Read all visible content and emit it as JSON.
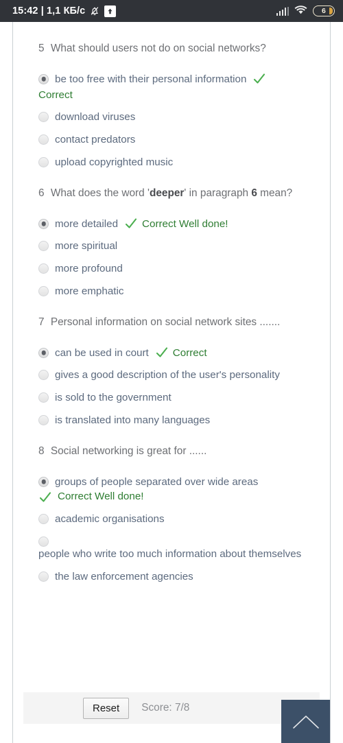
{
  "statusbar": {
    "clock": "15:42 | 1,1 КБ/с",
    "bell_icon": "bell-muted-icon",
    "upload_icon": "upload-arrow-icon",
    "signal_icon": "signal-bars-icon",
    "wifi_icon": "wifi-icon",
    "battery_level": "6"
  },
  "quiz": {
    "questions": [
      {
        "number": "5",
        "text": "What should users not do on social networks?",
        "options": [
          {
            "label": "be too free with their personal information",
            "selected": true,
            "mark": "check",
            "feedback": "Correct",
            "feedback_below": true
          },
          {
            "label": "download viruses",
            "selected": false
          },
          {
            "label": "contact predators",
            "selected": false
          },
          {
            "label": "upload copyrighted music",
            "selected": false
          }
        ]
      },
      {
        "number": "6",
        "text_before": "What does the word '",
        "text_bold": "deeper",
        "text_mid": "' in paragraph ",
        "text_bold2": "6",
        "text_after": " mean?",
        "options": [
          {
            "label": "more detailed",
            "selected": true,
            "mark": "check",
            "feedback": "Correct Well done!",
            "feedback_below": false
          },
          {
            "label": "more spiritual",
            "selected": false
          },
          {
            "label": "more profound",
            "selected": false
          },
          {
            "label": "more emphatic",
            "selected": false
          }
        ]
      },
      {
        "number": "7",
        "text": "Personal information on social network sites .......",
        "options": [
          {
            "label": "can be used in court",
            "selected": true,
            "mark": "check",
            "feedback": "Correct",
            "feedback_below": false
          },
          {
            "label": "gives a good description of the user's personality",
            "selected": false
          },
          {
            "label": "is sold to the government",
            "selected": false
          },
          {
            "label": "is translated into many languages",
            "selected": false
          }
        ]
      },
      {
        "number": "8",
        "text": "Social networking is great for ......",
        "options": [
          {
            "label": "groups of people separated over wide areas",
            "selected": true,
            "mark": "check",
            "feedback": "Correct Well done!",
            "feedback_below": true
          },
          {
            "label": "academic organisations",
            "selected": false
          },
          {
            "label": "people who write too much information about themselves",
            "selected": false
          },
          {
            "label": "the law enforcement agencies",
            "selected": false
          }
        ]
      }
    ]
  },
  "footer": {
    "reset_label": "Reset",
    "score_label": "Score: 7/8"
  },
  "scroll_top": {
    "icon": "chevron-up-icon",
    "color": "#3c5068"
  },
  "colors": {
    "question_text": "#6d6f73",
    "option_text": "#5c6a7e",
    "correct_green": "#2e7d32",
    "tick_green": "#4caf50",
    "statusbar_bg": "#303338"
  }
}
